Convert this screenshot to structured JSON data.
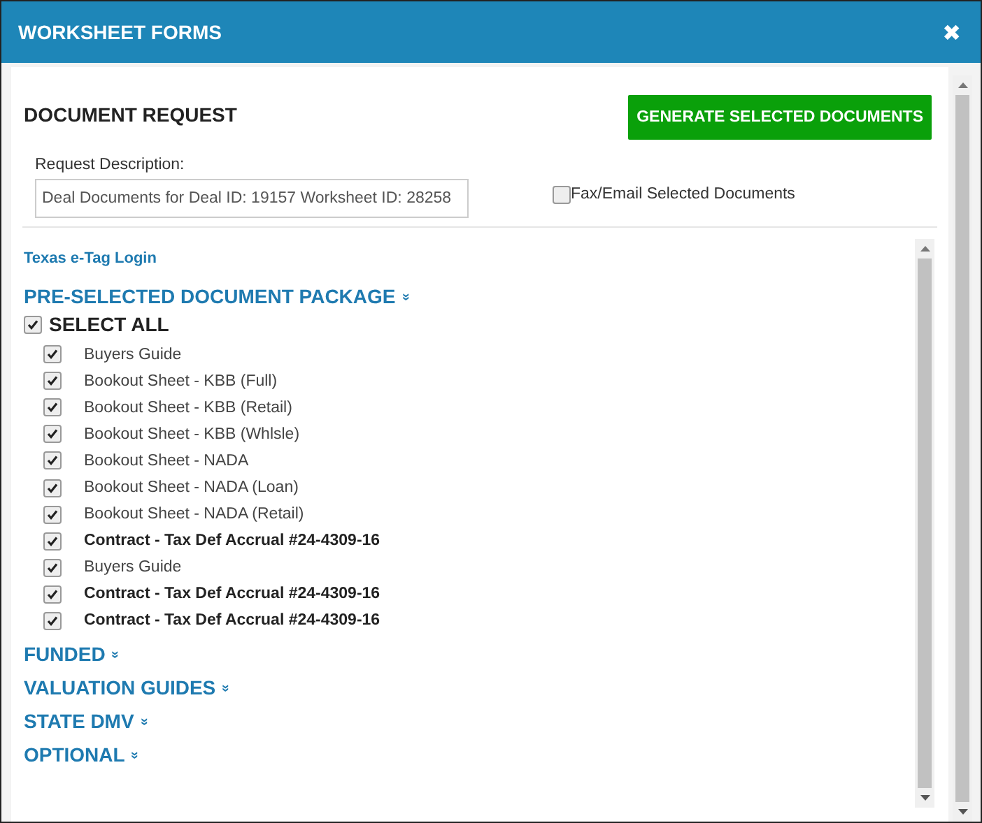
{
  "window": {
    "title": "WORKSHEET FORMS",
    "close": "✖"
  },
  "request": {
    "heading": "DOCUMENT REQUEST",
    "generate_button": "GENERATE SELECTED DOCUMENTS",
    "description_label": "Request Description:",
    "description_value": "Deal Documents for Deal ID: 19157 Worksheet ID: 28258",
    "fax_label": "Fax/Email Selected Documents",
    "fax_checked": false
  },
  "login_link": "Texas e-Tag Login",
  "package": {
    "title": "PRE-SELECTED DOCUMENT PACKAGE",
    "chevron": "»",
    "select_all": {
      "label": "SELECT ALL",
      "checked": true
    },
    "items": [
      {
        "label": "Buyers Guide",
        "checked": true,
        "kind": "normal"
      },
      {
        "label": "Bookout Sheet - KBB (Full)",
        "checked": true,
        "kind": "normal"
      },
      {
        "label": "Bookout Sheet - KBB (Retail)",
        "checked": true,
        "kind": "normal"
      },
      {
        "label": "Bookout Sheet - KBB (Whlsle)",
        "checked": true,
        "kind": "normal"
      },
      {
        "label": "Bookout Sheet - NADA",
        "checked": true,
        "kind": "normal"
      },
      {
        "label": "Bookout Sheet - NADA (Loan)",
        "checked": true,
        "kind": "normal"
      },
      {
        "label": "Bookout Sheet - NADA (Retail)",
        "checked": true,
        "kind": "normal"
      },
      {
        "label": "Contract - Tax Def Accrual #24-4309-16",
        "checked": true,
        "kind": "bold"
      },
      {
        "label": "Buyers Guide",
        "checked": true,
        "kind": "normal"
      },
      {
        "label": "Contract - Tax Def Accrual #24-4309-16",
        "checked": true,
        "kind": "bold"
      },
      {
        "label": "Contract - Tax Def Accrual #24-4309-16",
        "checked": true,
        "kind": "bold"
      }
    ]
  },
  "sections": [
    {
      "title": "FUNDED",
      "chevron": "»"
    },
    {
      "title": "VALUATION GUIDES",
      "chevron": "»"
    },
    {
      "title": "STATE DMV",
      "chevron": "»"
    },
    {
      "title": "OPTIONAL",
      "chevron": "»"
    }
  ]
}
